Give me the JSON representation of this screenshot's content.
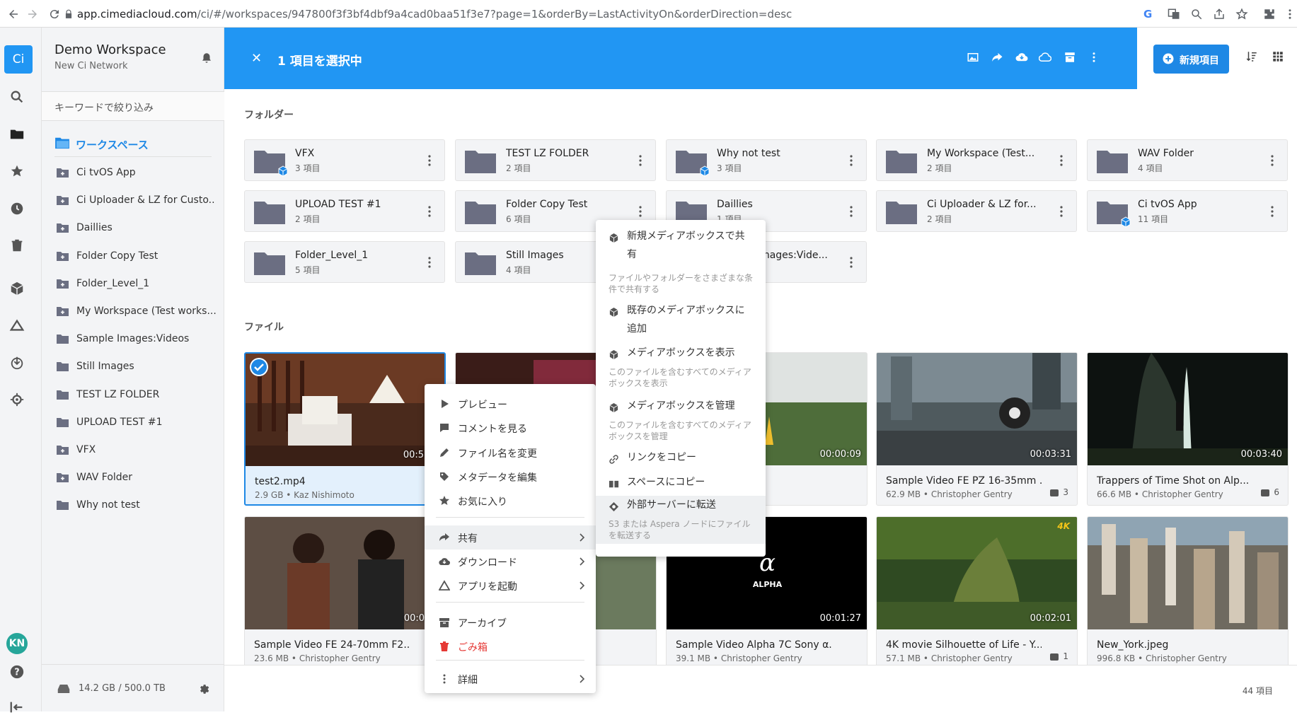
{
  "browser": {
    "url_host": "app.cimediacloud.com",
    "url_path": "/ci/#/workspaces/947800f3f3bf4dbf9a4cad0baa51f3e7?page=1&orderBy=LastActivityOn&orderDirection=desc"
  },
  "rail": {
    "logo": "Ci",
    "avatar": "KN"
  },
  "sidebar": {
    "workspace_name": "Demo Workspace",
    "network_name": "New Ci Network",
    "filter_placeholder": "キーワードで絞り込み",
    "workspaces_label": "ワークスペース",
    "items": [
      {
        "label": "Ci tvOS App",
        "shared": true
      },
      {
        "label": "Ci Uploader & LZ for Custo...",
        "shared": true
      },
      {
        "label": "Daillies",
        "shared": true
      },
      {
        "label": "Folder Copy Test",
        "shared": true
      },
      {
        "label": "Folder_Level_1",
        "shared": true
      },
      {
        "label": "My Workspace (Test works...",
        "shared": true
      },
      {
        "label": "Sample Images:Videos",
        "shared": false
      },
      {
        "label": "Still Images",
        "shared": false
      },
      {
        "label": "TEST LZ FOLDER",
        "shared": false
      },
      {
        "label": "UPLOAD TEST #1",
        "shared": false
      },
      {
        "label": "VFX",
        "shared": true
      },
      {
        "label": "WAV Folder",
        "shared": true
      },
      {
        "label": "Why not test",
        "shared": false
      }
    ],
    "storage": "14.2 GB / 500.0 TB"
  },
  "topbar": {
    "close": "✕",
    "selection": "1 項目を選択中",
    "new_item": "新規項目"
  },
  "folders_heading": "フォルダー",
  "folders": [
    {
      "name": "VFX",
      "count": "3 項目",
      "badge": true
    },
    {
      "name": "TEST LZ FOLDER",
      "count": "2 項目",
      "badge": false
    },
    {
      "name": "Why not test",
      "count": "3 項目",
      "badge": true
    },
    {
      "name": "My Workspace (Test...",
      "count": "2 項目",
      "badge": false
    },
    {
      "name": "WAV Folder",
      "count": "4 項目",
      "badge": false
    },
    {
      "name": "UPLOAD TEST #1",
      "count": "2 項目",
      "badge": false
    },
    {
      "name": "Folder Copy Test",
      "count": "6 項目",
      "badge": false
    },
    {
      "name": "Daillies",
      "count": "1 項目",
      "badge": false
    },
    {
      "name": "Ci Uploader & LZ for...",
      "count": "2 項目",
      "badge": false
    },
    {
      "name": "Ci tvOS App",
      "count": "11 項目",
      "badge": true
    },
    {
      "name": "Folder_Level_1",
      "count": "5 項目",
      "badge": false
    },
    {
      "name": "Still Images",
      "count": "4 項目",
      "badge": false
    },
    {
      "name": "Sample Images:Vide...",
      "count": "",
      "badge": false
    }
  ],
  "files_heading": "ファイル",
  "files": [
    {
      "name": "test2.mp4",
      "meta": "2.9 GB • Kaz Nishimoto",
      "duration": "00:50:3",
      "comments": "",
      "selected": true
    },
    {
      "name": "",
      "meta": "",
      "duration": "",
      "comments": ""
    },
    {
      "name": "",
      "meta": "Gentry",
      "duration": "00:00:09",
      "comments": ""
    },
    {
      "name": "Sample Video FE PZ 16-35mm ...",
      "meta": "62.9 MB • Christopher Gentry",
      "duration": "00:03:31",
      "comments": "3"
    },
    {
      "name": "Trappers of Time Shot on Alp...",
      "meta": "66.6 MB • Christopher Gentry",
      "duration": "00:03:40",
      "comments": "6"
    },
    {
      "name": "Sample Video FE 24-70mm F2....",
      "meta": "23.6 MB • Christopher Gentry",
      "duration": "00:01:3",
      "comments": ""
    },
    {
      "name": "",
      "meta": "",
      "duration": "",
      "comments": ""
    },
    {
      "name": "Sample Video Alpha 7C Sony α....",
      "meta": "39.1 MB • Christopher Gentry",
      "duration": "00:01:27",
      "comments": "",
      "logo": "α",
      "logo_text": "ALPHA"
    },
    {
      "name": "4K movie Silhouette of Life - Y...",
      "meta": "57.1 MB • Christopher Gentry",
      "duration": "00:02:01",
      "comments": "1",
      "badge": "4K"
    },
    {
      "name": "New_York.jpeg",
      "meta": "996.8 KB • Christopher Gentry",
      "duration": "",
      "comments": ""
    }
  ],
  "item_count": "44 項目",
  "context_menu": [
    {
      "label": "プレビュー",
      "icon": "play-icon"
    },
    {
      "label": "コメントを見る",
      "icon": "comment-icon"
    },
    {
      "label": "ファイル名を変更",
      "icon": "pencil-icon"
    },
    {
      "label": "メタデータを編集",
      "icon": "tag-icon"
    },
    {
      "label": "お気に入り",
      "icon": "star-icon"
    },
    {
      "label": "共有",
      "icon": "share-icon",
      "submenu": true,
      "active": true
    },
    {
      "label": "ダウンロード",
      "icon": "cloud-download-icon",
      "submenu": true
    },
    {
      "label": "アプリを起動",
      "icon": "cloud-icon",
      "submenu": true
    },
    {
      "label": "アーカイブ",
      "icon": "archive-icon"
    },
    {
      "label": "ごみ箱",
      "icon": "trash-icon",
      "danger": true
    },
    {
      "label": "詳細",
      "icon": "more-vertical-icon",
      "submenu": true
    }
  ],
  "share_submenu": [
    {
      "title": "新規メディアボックスで共有",
      "desc": "ファイルやフォルダーをさまざまな条件で共有する"
    },
    {
      "title": "既存のメディアボックスに追加",
      "desc": ""
    },
    {
      "title": "メディアボックスを表示",
      "desc": "このファイルを含むすべてのメディアボックスを表示"
    },
    {
      "title": "メディアボックスを管理",
      "desc": "このファイルを含むすべてのメディアボックスを管理"
    },
    {
      "title": "リンクをコピー",
      "desc": ""
    },
    {
      "title": "スペースにコピー",
      "desc": ""
    },
    {
      "title": "外部サーバーに転送",
      "desc": "S3 または Aspera ノードにファイルを転送する",
      "active": true
    }
  ],
  "colors": {
    "accent": "#2196f3",
    "danger": "#e53935",
    "folder": "#6b6f82"
  }
}
